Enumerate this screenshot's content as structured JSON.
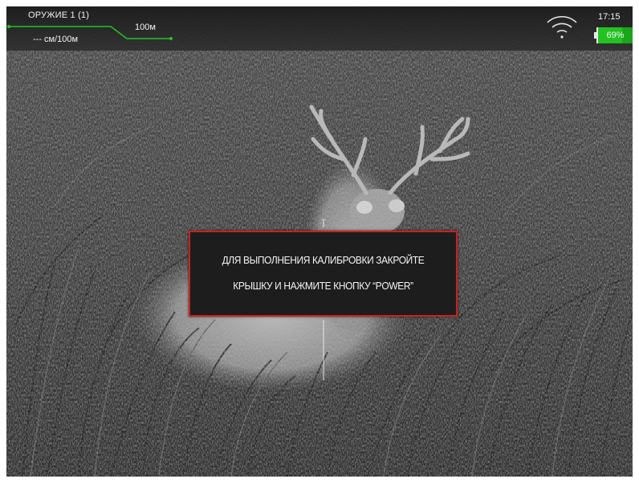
{
  "status": {
    "weapon_profile": "ОРУЖИЕ 1 (1)",
    "zero_distance": "100м",
    "offset": "--- см/100м",
    "time": "17:15",
    "battery_percent": 69,
    "battery_label": "69%",
    "wifi_icon": "wifi-icon",
    "accent_color": "#22c322"
  },
  "dialog": {
    "line1": "ДЛЯ ВЫПОЛНЕНИЯ КАЛИБРОВКИ ЗАКРОЙТЕ",
    "line2": "КРЫШКУ И НАЖМИТЕ КНОПКУ “POWER”",
    "border_color": "#cc2121"
  },
  "scene": {
    "description": "thermal-image-deer-in-grass"
  }
}
